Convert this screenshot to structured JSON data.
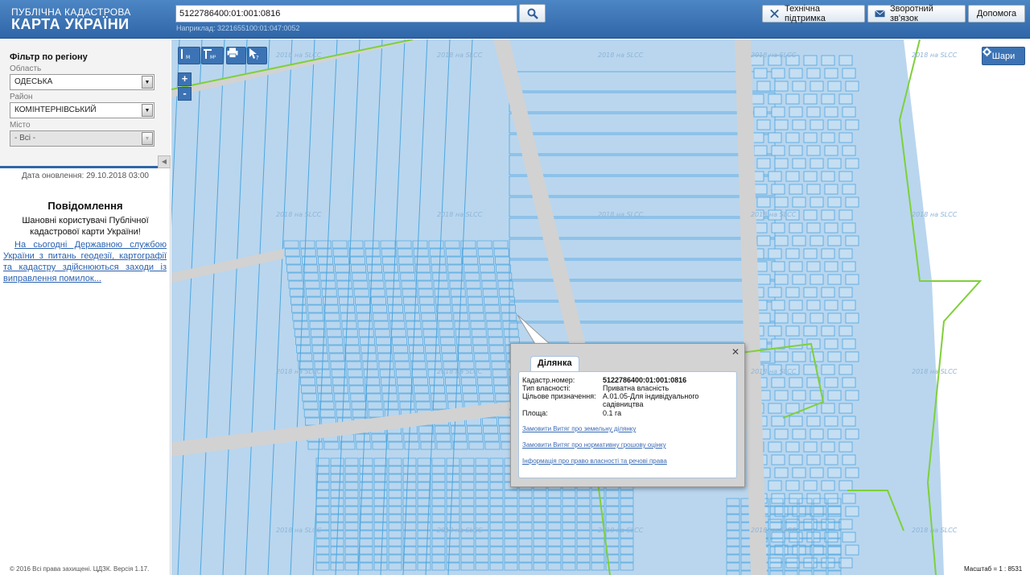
{
  "header": {
    "logo_line1": "ПУБЛІЧНА КАДАСТРОВА",
    "logo_line2": "КАРТА УКРАЇНИ",
    "search_value": "5122786400:01:001:0816",
    "search_example": "Наприклад: 3221655100:01:047:0052",
    "support_label": "Технічна підтримка",
    "feedback_label": "Зворотний зв'язок",
    "help_label": "Допомога"
  },
  "sidebar": {
    "filter_title": "Фільтр по регіону",
    "region_label": "Область",
    "region_value": "ОДЕСЬКА",
    "district_label": "Район",
    "district_value": "КОМІНТЕРНІВСЬКИЙ",
    "city_label": "Місто",
    "city_value": "- Всі -",
    "update_date": "Дата оновлення: 29.10.2018 03:00",
    "message_title": "Повідомлення",
    "message_greeting": "Шановні користувачі Публічної кадастрової карти України!",
    "message_link": "На сьогодні Державною службою України з питань геодезії, картографії та кадастру здійснюються заходи із виправлення помилок...",
    "copyright": "© 2016 Всі права захищені. ЦДЗК. Версія 1.17."
  },
  "map": {
    "layers_label": "Шари",
    "zoom_in": "+",
    "zoom_out": "-",
    "scale_text": "Масштаб = 1 : 8531",
    "watermark": "2018 на SLCC",
    "tools": [
      "measure-distance-icon",
      "measure-area-icon",
      "print-icon",
      "identify-icon"
    ]
  },
  "popup": {
    "tab_label": "Ділянка",
    "close_label": "✕",
    "rows": [
      {
        "key": "Кадастр.номер:",
        "value": "5122786400:01:001:0816",
        "bold": true
      },
      {
        "key": "Тип власності:",
        "value": "Приватна власність",
        "bold": false
      },
      {
        "key": "Цільове призначення:",
        "value": "А.01.05-Для індивідуального садівництва",
        "bold": false
      },
      {
        "key": "Площа:",
        "value": "0.1 га",
        "bold": false
      }
    ],
    "links": [
      "Замовити Витяг про земельну ділянку",
      "Замовити Витяг про нормативну грошову оцінку",
      "Інформація про право власності та речові права"
    ]
  },
  "colors": {
    "header": "#2f66a8",
    "parcel_fill": "#b9d6ee",
    "parcel_stroke": "#4ea6e0",
    "road": "#d2d2d2",
    "boundary": "#7fd03a"
  }
}
